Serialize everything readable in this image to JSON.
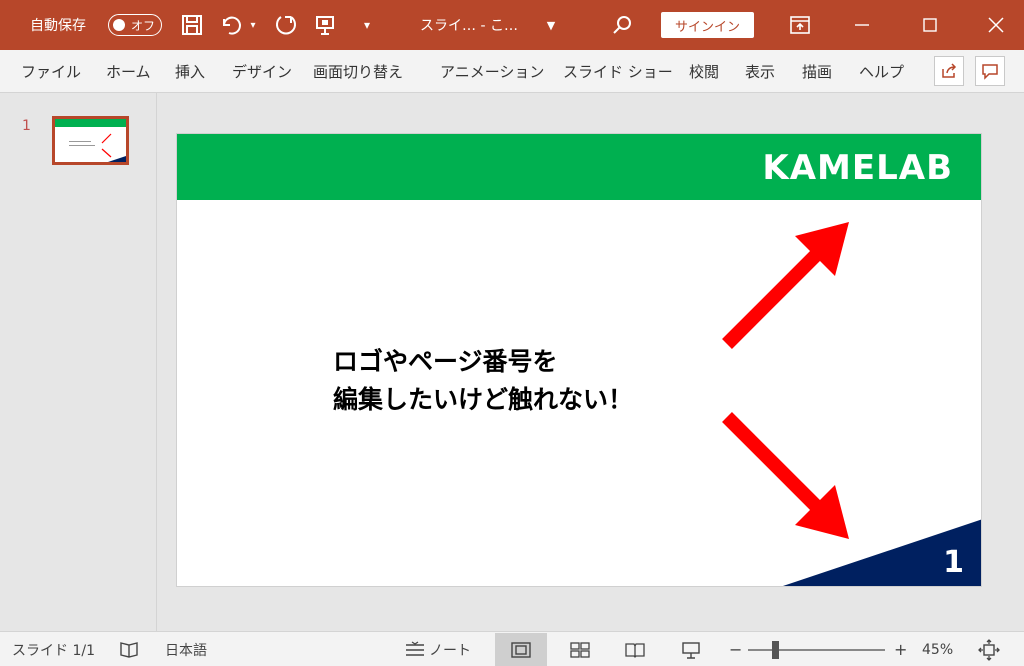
{
  "titlebar": {
    "autosave_label": "自動保存",
    "toggle_label": "オフ",
    "doc_title": "スライ… - こ…",
    "signin_label": "サインイン",
    "save_icon": "save-icon",
    "undo_icon": "undo-icon",
    "redo_icon": "redo-icon",
    "present_icon": "present-icon",
    "search_icon": "search-icon",
    "accent_color": "#b7472a"
  },
  "ribbon": {
    "tabs": [
      "ファイル",
      "ホーム",
      "挿入",
      "デザイン",
      "画面切り替え",
      "アニメーション",
      "スライド ショー",
      "校閲",
      "表示",
      "描画",
      "ヘルプ"
    ]
  },
  "thumbnails": {
    "slide_number": "1"
  },
  "slide": {
    "logo": "KAMELAB",
    "text_line1": "ロゴやページ番号を",
    "text_line2": "編集したいけど触れない！",
    "page_number": "1",
    "bar_color": "#00b050",
    "arrow_color": "#ff0000",
    "corner_color": "#002060"
  },
  "statusbar": {
    "slide_info": "スライド 1/1",
    "language": "日本語",
    "notes_label": "ノート",
    "zoom_minus": "−",
    "zoom_plus": "+",
    "zoom_level": "45%",
    "zoom_fraction": 0.45
  }
}
